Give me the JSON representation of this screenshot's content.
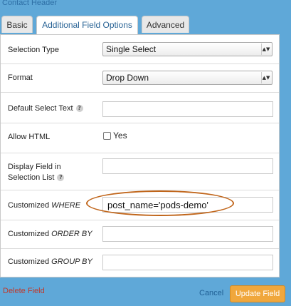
{
  "header": {
    "title": "Contact Header"
  },
  "tabs": [
    {
      "label": "Basic"
    },
    {
      "label": "Additional Field Options",
      "active": true
    },
    {
      "label": "Advanced"
    }
  ],
  "fields": {
    "selection_type": {
      "label": "Selection Type",
      "value": "Single Select"
    },
    "format": {
      "label": "Format",
      "value": "Drop Down"
    },
    "default_select_text": {
      "label": "Default Select Text",
      "value": "",
      "help_icon": "help-icon"
    },
    "allow_html": {
      "label": "Allow HTML",
      "checkbox_label": "Yes",
      "checked": false
    },
    "display_field": {
      "label_line1": "Display Field in",
      "label_line2": "Selection List",
      "value": "",
      "help_icon": "help-icon"
    },
    "customized_where": {
      "label_prefix": "Customized ",
      "label_em": "WHERE",
      "value": "post_name='pods-demo'"
    },
    "customized_order_by": {
      "label_prefix": "Customized ",
      "label_em": "ORDER BY",
      "value": ""
    },
    "customized_group_by": {
      "label_prefix": "Customized ",
      "label_em": "GROUP BY",
      "value": ""
    }
  },
  "footer": {
    "delete_label": "Delete Field",
    "cancel_label": "Cancel",
    "update_label": "Update Field"
  },
  "colors": {
    "background": "#5fa8d8",
    "highlight_ring": "#c0651a",
    "update_button": "#f0a73c",
    "delete_link": "#c0392b"
  }
}
